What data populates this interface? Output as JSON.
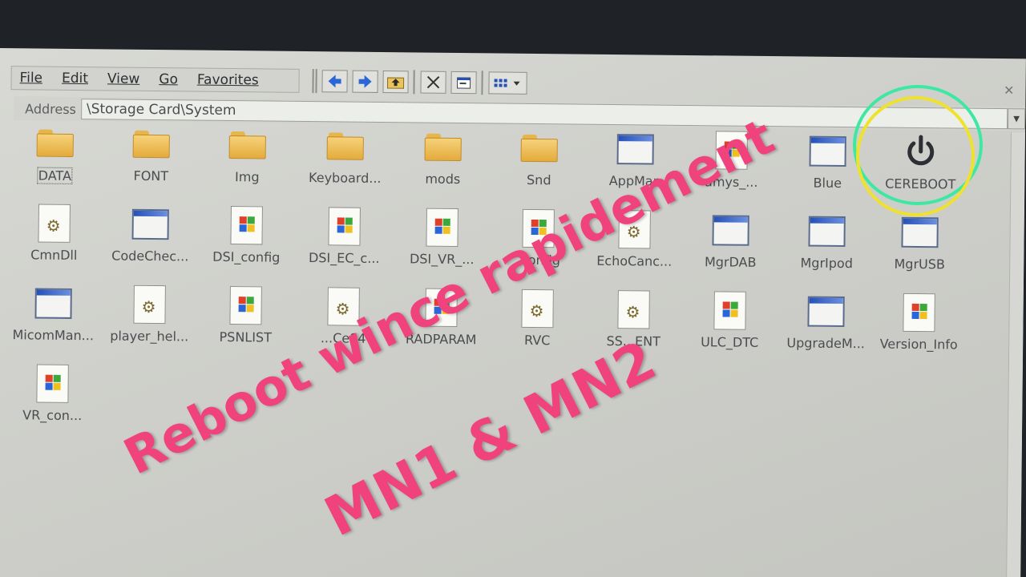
{
  "menu": [
    "File",
    "Edit",
    "View",
    "Go",
    "Favorites"
  ],
  "address": {
    "label": "Address",
    "value": "\\Storage Card\\System"
  },
  "files": [
    {
      "label": "DATA",
      "type": "folder"
    },
    {
      "label": "FONT",
      "type": "folder"
    },
    {
      "label": "Img",
      "type": "folder"
    },
    {
      "label": "Keyboard...",
      "type": "folder"
    },
    {
      "label": "mods",
      "type": "folder"
    },
    {
      "label": "Snd",
      "type": "folder"
    },
    {
      "label": "AppMan",
      "type": "app"
    },
    {
      "label": "amys_...",
      "type": "config"
    },
    {
      "label": "Blue",
      "type": "app"
    },
    {
      "label": "CEREBOOT",
      "type": "power"
    },
    {
      "label": "CmnDll",
      "type": "dll"
    },
    {
      "label": "CodeChec...",
      "type": "app"
    },
    {
      "label": "DSI_config",
      "type": "config"
    },
    {
      "label": "DSI_EC_c...",
      "type": "config"
    },
    {
      "label": "DSI_VR_...",
      "type": "config"
    },
    {
      "label": "...onfig",
      "type": "config"
    },
    {
      "label": "EchoCanc...",
      "type": "dll"
    },
    {
      "label": "MgrDAB",
      "type": "app"
    },
    {
      "label": "MgrIpod",
      "type": "app"
    },
    {
      "label": "MgrUSB",
      "type": "app"
    },
    {
      "label": "MicomMan...",
      "type": "app"
    },
    {
      "label": "player_hel...",
      "type": "dll"
    },
    {
      "label": "PSNLIST",
      "type": "config"
    },
    {
      "label": "...Ce84",
      "type": "dll"
    },
    {
      "label": "RADPARAM",
      "type": "config"
    },
    {
      "label": "RVC",
      "type": "dll"
    },
    {
      "label": "SS...ENT",
      "type": "dll"
    },
    {
      "label": "ULC_DTC",
      "type": "config"
    },
    {
      "label": "UpgradeM...",
      "type": "app"
    },
    {
      "label": "Version_Info",
      "type": "config"
    },
    {
      "label": "VR_con...",
      "type": "config"
    }
  ],
  "overlay": {
    "line1": "Reboot wince rapidement",
    "line2": "MN1 & MN2"
  },
  "colors": {
    "overlay": "#f0427d",
    "ring_green": "#3ee8a2",
    "ring_yellow": "#efe22e"
  },
  "icons": [
    "back-arrow-icon",
    "forward-arrow-icon",
    "up-folder-icon",
    "cut-icon",
    "properties-icon",
    "view-icon"
  ]
}
